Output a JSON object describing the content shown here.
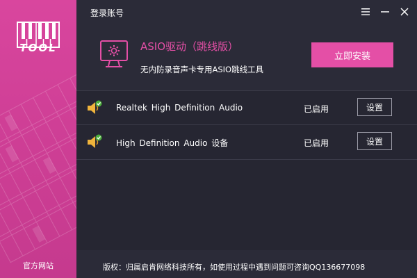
{
  "sidebar": {
    "logo_text": "TOOL",
    "official_site": "官方网站"
  },
  "titlebar": {
    "login": "登录账号",
    "icons": [
      "menu-icon",
      "minimize-icon",
      "close-icon"
    ]
  },
  "promo": {
    "title": "ASIO驱动（跳线版）",
    "description": "无内防录音声卡专用ASIO跳线工具",
    "install_label": "立即安装",
    "icon": "monitor-gear-icon"
  },
  "devices": [
    {
      "name": "Realtek High Definition Audio",
      "status": "已启用",
      "settings_label": "设置",
      "icon": "speaker-check-icon"
    },
    {
      "name": "High Definition Audio 设备",
      "status": "已启用",
      "settings_label": "设置",
      "icon": "speaker-check-icon"
    }
  ],
  "footer": {
    "copyright": "版权：归属启肯网络科技所有，如使用过程中遇到问题可咨询QQ136677098"
  },
  "colors": {
    "accent": "#e44fa6",
    "sidebar": "#d9469e",
    "background": "#2b2b38",
    "list_background": "#262632"
  }
}
